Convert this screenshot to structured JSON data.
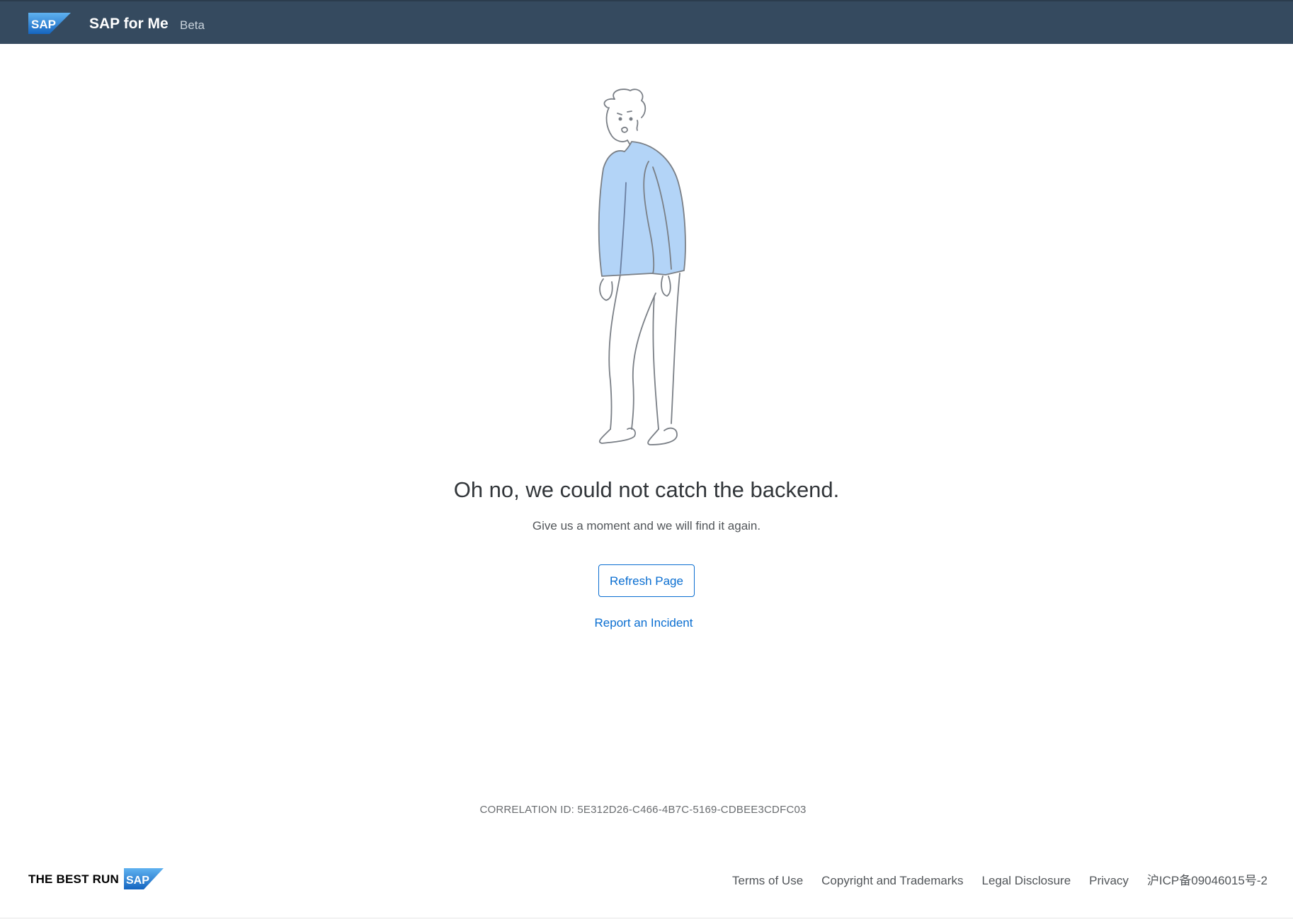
{
  "header": {
    "logo_text": "SAP",
    "app_title": "SAP for Me",
    "badge": "Beta"
  },
  "error": {
    "headline": "Oh no, we could not catch the backend.",
    "message": "Give us a moment and we will find it again.",
    "refresh_label": "Refresh Page",
    "report_label": "Report an Incident",
    "correlation_id": "CORRELATION ID: 5E312D26-C466-4B7C-5169-CDBEE3CDFC03",
    "illustration_icon": "sad-person-illustration"
  },
  "footer": {
    "tagline": "THE BEST RUN",
    "logo_text": "SAP",
    "links": [
      "Terms of Use",
      "Copyright and Trademarks",
      "Legal Disclosure",
      "Privacy",
      "沪ICP备09046015号-2"
    ]
  },
  "colors": {
    "shell": "#354a5f",
    "accent": "#0a6ed1",
    "sweater": "#b3d4f7",
    "brand_blue": "#1a7bd6"
  }
}
